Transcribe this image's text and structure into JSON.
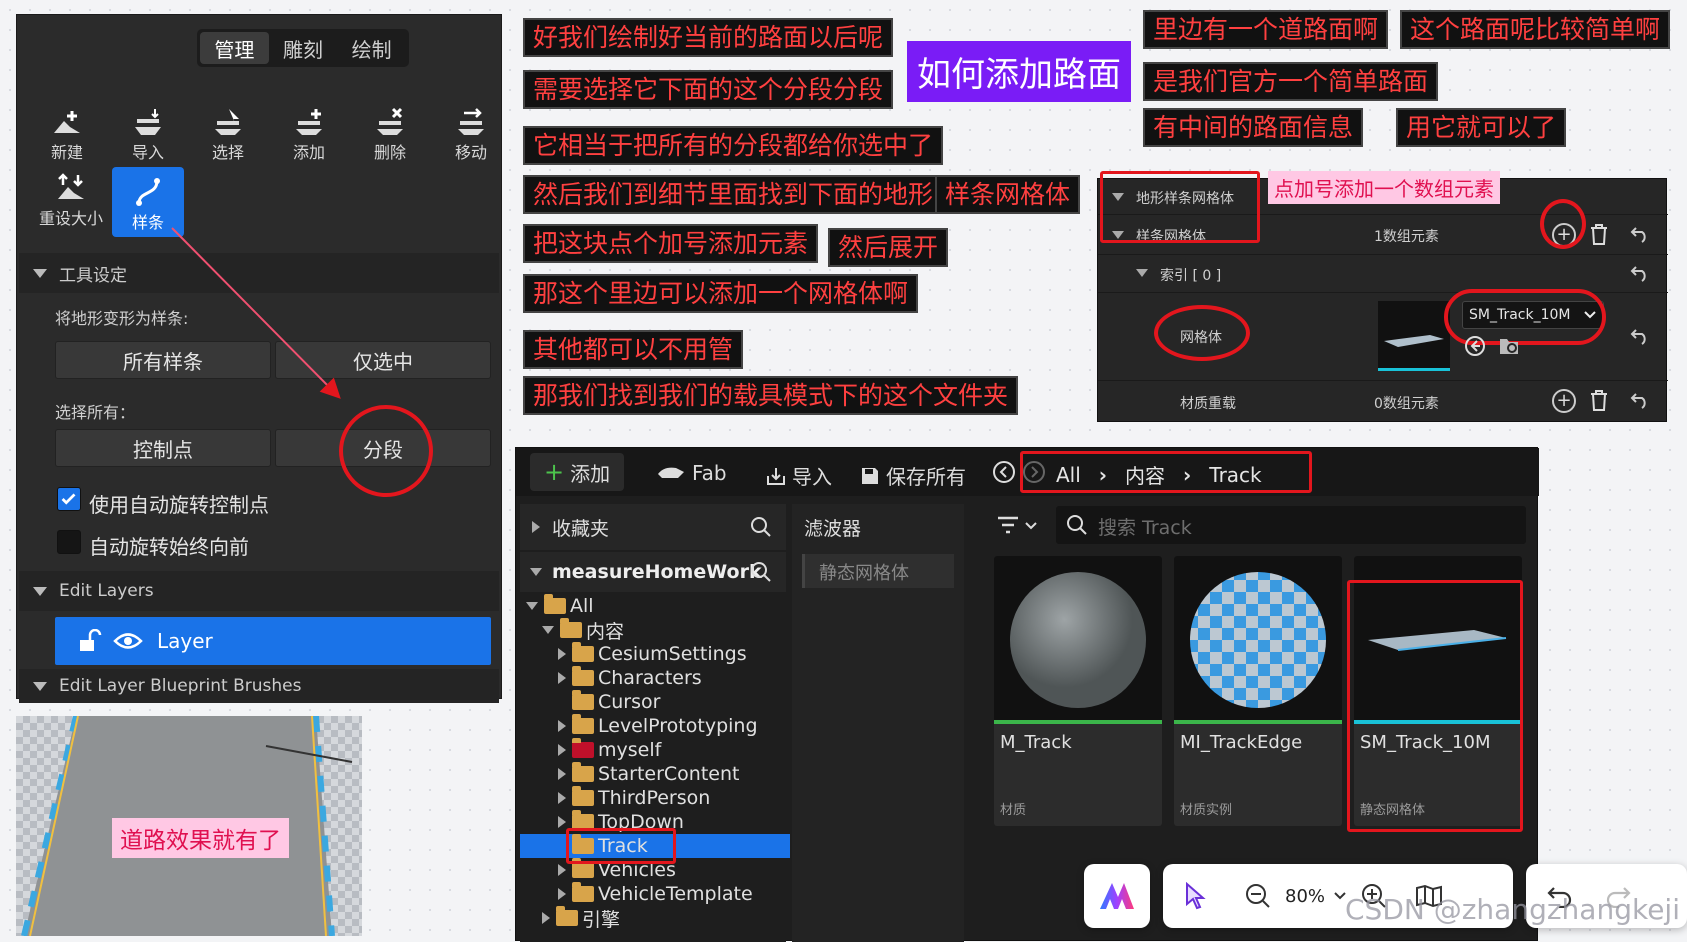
{
  "left_panel": {
    "mode_tabs": [
      "管理",
      "雕刻",
      "绘制"
    ],
    "tools": [
      {
        "label": "新建",
        "icon": "new-icon"
      },
      {
        "label": "导入",
        "icon": "import-icon"
      },
      {
        "label": "选择",
        "icon": "select-icon"
      },
      {
        "label": "添加",
        "icon": "add-icon"
      },
      {
        "label": "删除",
        "icon": "delete-icon"
      },
      {
        "label": "移动",
        "icon": "move-icon"
      },
      {
        "label": "重设大小",
        "icon": "resize-icon"
      },
      {
        "label": "样条",
        "icon": "spline-icon"
      }
    ],
    "tool_settings_header": "工具设定",
    "deform_label": "将地形变形为样条:",
    "all_splines_btn": "所有样条",
    "only_selected_btn": "仅选中",
    "select_all_label": "选择所有：",
    "control_points_btn": "控制点",
    "segments_btn": "分段",
    "auto_rotate_label": "使用自动旋转控制点",
    "auto_rotate_forward_label": "自动旋转始终向前",
    "edit_layers_header": "Edit Layers",
    "layer_name": "Layer",
    "edit_layer_brushes_header": "Edit Layer Blueprint Brushes"
  },
  "road_caption": "道路效果就有了",
  "title_caption": "如何添加路面",
  "captions": [
    "好我们绘制好当前的路面以后呢",
    "需要选择它下面的这个分段分段",
    "它相当于把所有的分段都给你选中了",
    "然后我们到细节里面找到下面的地形",
    "样条网格体",
    "把这块点个加号添加元素",
    "然后展开",
    "那这个里边可以添加一个网格体啊",
    "其他都可以不用管",
    "那我们找到我们的载具模式下的这个文件夹",
    "里边有一个道路面啊",
    "这个路面呢比较简单啊",
    "是我们官方一个简单路面",
    "有中间的路面信息",
    "用它就可以了"
  ],
  "details": {
    "landscape_spline_mesh": "地形样条网格体",
    "spline_meshes": "样条网格体",
    "array_count_1": "1数组元素",
    "index_label": "索引 [ 0 ]",
    "mesh_label": "网格体",
    "mesh_value": "SM_Track_10M",
    "material_override": "材质重载",
    "array_count_0": "0数组元素",
    "hint": "点加号添加一个数组元素"
  },
  "browser": {
    "add_btn": "添加",
    "fab_btn": "Fab",
    "import_btn": "导入",
    "save_all_btn": "保存所有",
    "breadcrumb": [
      "All",
      "内容",
      "Track"
    ],
    "favorites": "收藏夹",
    "project": "measureHomeWork",
    "filters": "滤波器",
    "filter_chip": "静态网格体",
    "search_placeholder": "搜索 Track",
    "tree": [
      {
        "label": "All",
        "level": 0
      },
      {
        "label": "内容",
        "level": 1
      },
      {
        "label": "CesiumSettings",
        "level": 2
      },
      {
        "label": "Characters",
        "level": 2
      },
      {
        "label": "Cursor",
        "level": 2
      },
      {
        "label": "LevelPrototyping",
        "level": 2
      },
      {
        "label": "myself",
        "level": 2
      },
      {
        "label": "StarterContent",
        "level": 2
      },
      {
        "label": "ThirdPerson",
        "level": 2
      },
      {
        "label": "TopDown",
        "level": 2
      },
      {
        "label": "Track",
        "level": 2
      },
      {
        "label": "Vehicles",
        "level": 2
      },
      {
        "label": "VehicleTemplate",
        "level": 2
      },
      {
        "label": "引擎",
        "level": 1
      }
    ],
    "assets": [
      {
        "name": "M_Track",
        "type": "材质",
        "bar": "#3bb54a"
      },
      {
        "name": "MI_TrackEdge",
        "type": "材质实例",
        "bar": "#3bb54a"
      },
      {
        "name": "SM_Track_10M",
        "type": "静态网格体",
        "bar": "#19c2d8"
      }
    ]
  },
  "zoom": {
    "level": "80%"
  },
  "watermark": "CSDN @zhangzhangkeji"
}
